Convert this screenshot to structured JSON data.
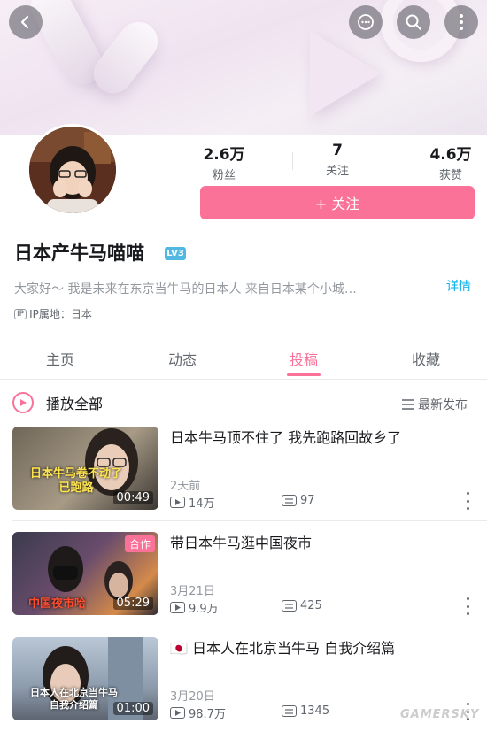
{
  "header": {
    "back_icon": "back-arrow-icon",
    "icons": [
      "message-icon",
      "search-icon",
      "more-icon"
    ]
  },
  "profile": {
    "name": "日本产牛马喵喵",
    "level": "LV3",
    "bio": "大家好～ 我是未来在东京当牛马的日本人 来自日本某个小城…",
    "detail_label": "详情",
    "ip_badge": "IP",
    "ip_text": "IP属地：日本"
  },
  "stats": [
    {
      "value": "2.6万",
      "label": "粉丝"
    },
    {
      "value": "7",
      "label": "关注"
    },
    {
      "value": "4.6万",
      "label": "获赞"
    }
  ],
  "follow_button": "+ 关注",
  "tabs": [
    {
      "label": "主页"
    },
    {
      "label": "动态"
    },
    {
      "label": "投稿",
      "active": true
    },
    {
      "label": "收藏"
    }
  ],
  "list_header": {
    "play_all": "播放全部",
    "sort": "最新发布"
  },
  "videos": [
    {
      "title": "日本牛马顶不住了 我先跑路回故乡了",
      "date": "2天前",
      "plays": "14万",
      "danmu": "97",
      "duration": "00:49",
      "thumb_text": "日本牛马卷不动了\n已跑路",
      "badge": ""
    },
    {
      "title": "带日本牛马逛中国夜市",
      "date": "3月21日",
      "plays": "9.9万",
      "danmu": "425",
      "duration": "05:29",
      "thumb_text": "中国夜市哈",
      "badge": "合作"
    },
    {
      "title": "🇯🇵 日本人在北京当牛马 自我介绍篇",
      "date": "3月20日",
      "plays": "98.7万",
      "danmu": "1345",
      "duration": "01:00",
      "thumb_text": "日本人在北京当牛马\n自我介绍篇",
      "badge": ""
    }
  ],
  "watermark": "GAMERSKY",
  "colors": {
    "accent": "#fb7299",
    "link": "#00aeec",
    "level": "#51b7e3"
  }
}
